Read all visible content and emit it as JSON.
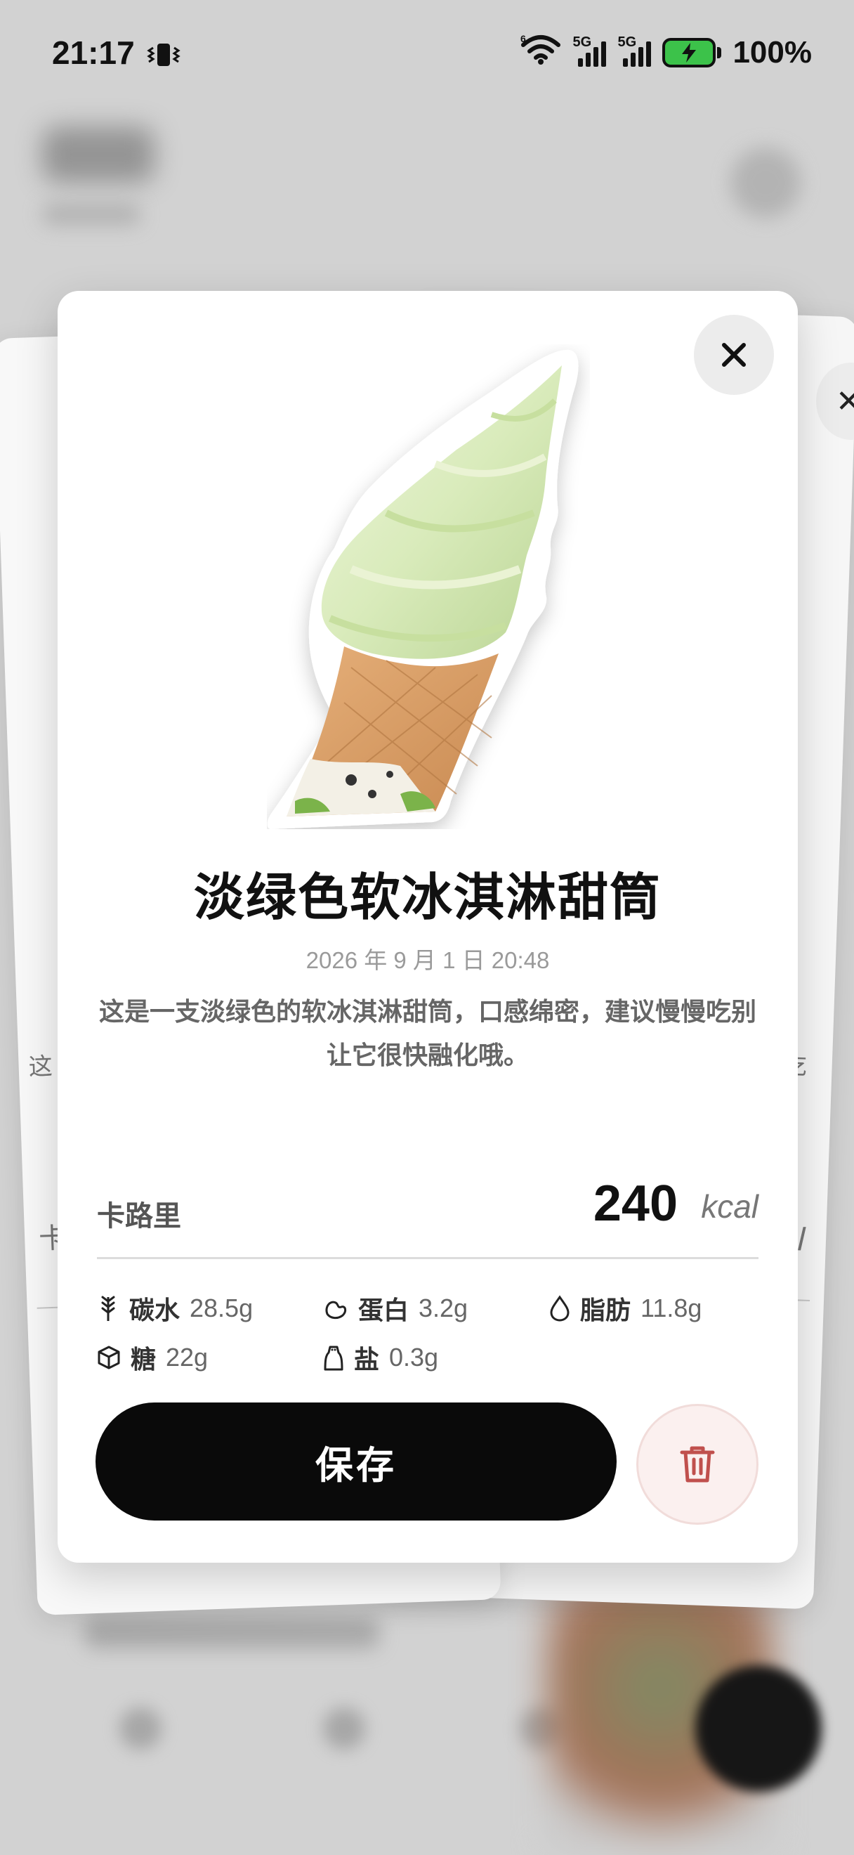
{
  "status_bar": {
    "time": "21:17",
    "signal_1_label": "5G",
    "signal_2_label": "5G",
    "battery": "100%"
  },
  "background": {
    "left_card_text": "这",
    "left_card_cal_label": "卡",
    "right_card_text": "吃",
    "right_card_cal_unit": "al"
  },
  "food": {
    "title": "淡绿色软冰淇淋甜筒",
    "date": "2026 年 9 月 1 日 20:48",
    "description": "这是一支淡绿色的软冰淇淋甜筒，口感绵密，建议慢慢吃别让它很快融化哦。"
  },
  "calories": {
    "label": "卡路里",
    "value": "240",
    "unit": "kcal"
  },
  "nutrients": {
    "carbs": {
      "label": "碳水",
      "value": "28.5g",
      "icon": "wheat-icon"
    },
    "protein": {
      "label": "蛋白",
      "value": "3.2g",
      "icon": "bean-icon"
    },
    "fat": {
      "label": "脂肪",
      "value": "11.8g",
      "icon": "drop-icon"
    },
    "sugar": {
      "label": "糖",
      "value": "22g",
      "icon": "cube-icon"
    },
    "salt": {
      "label": "盐",
      "value": "0.3g",
      "icon": "salt-shaker-icon"
    }
  },
  "actions": {
    "save_label": "保存",
    "delete_icon": "trash-icon",
    "close_icon": "close-icon"
  },
  "colors": {
    "primary_button": "#0a0a0a",
    "delete_tint": "#fbf0ef",
    "delete_icon": "#c0504d",
    "battery_fill": "#3cc24a"
  }
}
